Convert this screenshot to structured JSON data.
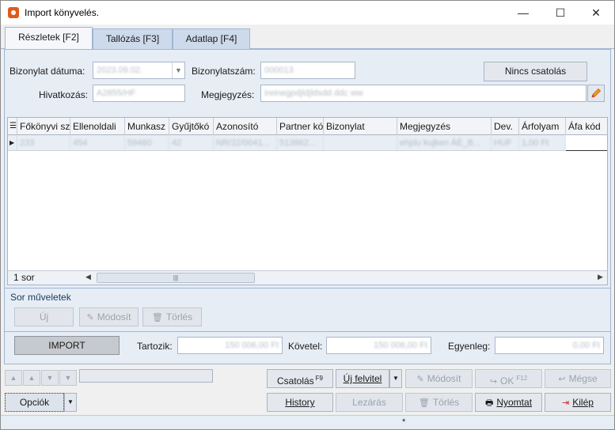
{
  "window": {
    "title": "Import könyvelés.",
    "minimize_glyph": "—",
    "maximize_glyph": "☐",
    "close_glyph": "✕"
  },
  "tabs": [
    {
      "label": "Részletek [F2]",
      "active": true
    },
    {
      "label": "Tallózás [F3]",
      "active": false
    },
    {
      "label": "Adatlap [F4]",
      "active": false
    }
  ],
  "form": {
    "date_label": "Bizonylat dátuma:",
    "date_value": "2023.09.02.",
    "doc_number_label": "Bizonylatszám:",
    "doc_number_value": "000013",
    "reference_label": "Hivatkozás:",
    "reference_value": "A2855/HF",
    "note_label": "Megjegyzés:",
    "note_value": "ireinegpdjldjldsdd ddc ww",
    "attachment_button": "Nincs csatolás"
  },
  "grid": {
    "columns": [
      "Főkönyvi sz",
      "Ellenoldali",
      "Munkasz",
      "Gyűjtőkó",
      "Azonosító",
      "Partner kó",
      "Bizonylat",
      "Megjegyzés",
      "Dev.",
      "Árfolyam",
      "Áfa kód"
    ],
    "rows": [
      [
        "233",
        "454",
        "59460",
        "42",
        "NR/22/0041...",
        "513862...",
        "",
        "ehjdu kujken ÁÉ_B...",
        "HUF",
        "1,00 Ft",
        ""
      ]
    ],
    "row_count": "1 sor",
    "scroll_glyphs": {
      "left": "◀",
      "right": "▶",
      "grip": "|||"
    }
  },
  "row_actions": {
    "title": "Sor műveletek",
    "new_label": "Új",
    "edit_label": "Módosít",
    "delete_label": "Törlés"
  },
  "totals": {
    "import_label": "IMPORT",
    "debit_label": "Tartozik:",
    "debit_value": "150 006,00 Ft",
    "credit_label": "Követel:",
    "credit_value": "150 006,00 Ft",
    "balance_label": "Egyenleg:",
    "balance_value": "0,00 Ft"
  },
  "footer": {
    "options_label": "Opciók",
    "attach_label": "Csatolás",
    "attach_shortcut": "F9",
    "new_entry_label": "Új felvitel",
    "edit_label": "Módosít",
    "ok_label": "OK",
    "ok_shortcut": "F12",
    "cancel_label": "Mégse",
    "history_label": "History",
    "close_label": "Lezárás",
    "delete_label": "Törlés",
    "print_label": "Nyomtat",
    "exit_label": "Kilép"
  },
  "status": {
    "text": "*"
  }
}
